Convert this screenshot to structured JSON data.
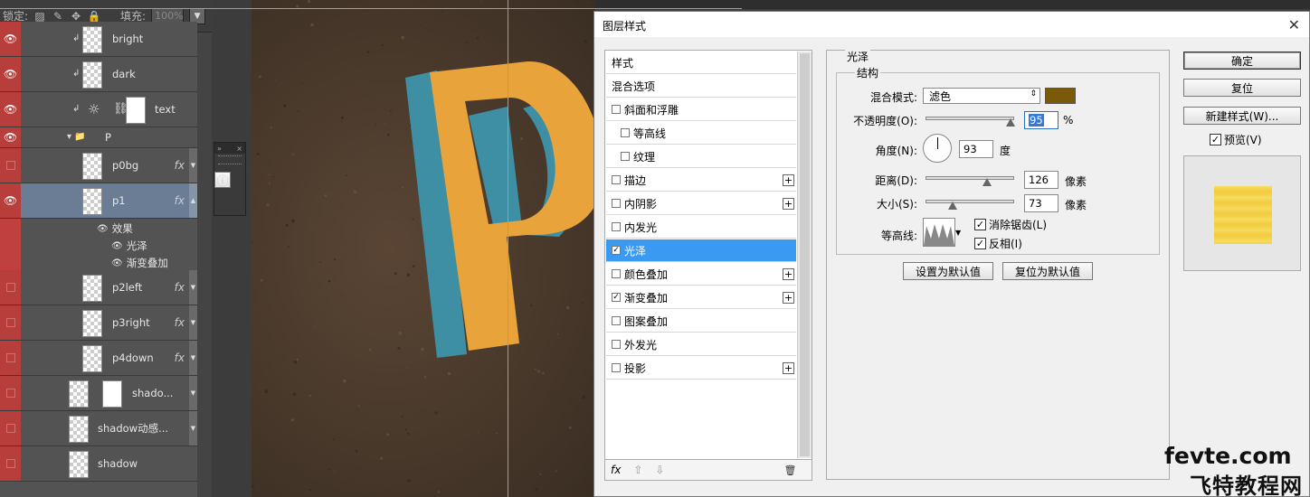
{
  "lock_bar": {
    "lock_label": "锁定:",
    "fill_label": "填充:",
    "fill_value": "100%"
  },
  "layers": {
    "rows": [
      {
        "name": "bright",
        "visible": true,
        "fx": false
      },
      {
        "name": "dark",
        "visible": true,
        "fx": false
      },
      {
        "name": "text",
        "visible": true,
        "fx": false
      },
      {
        "name": "P",
        "visible": true,
        "fx": false,
        "type": "group"
      },
      {
        "name": "p0bg",
        "visible": false,
        "fx": true,
        "fx_label": "fx"
      },
      {
        "name": "p1",
        "visible": true,
        "fx": true,
        "fx_label": "fx",
        "selected": true
      },
      {
        "name": "p2left",
        "visible": false,
        "fx": true,
        "fx_label": "fx"
      },
      {
        "name": "p3right",
        "visible": false,
        "fx": true,
        "fx_label": "fx"
      },
      {
        "name": "p4down",
        "visible": false,
        "fx": true,
        "fx_label": "fx"
      },
      {
        "name": "shado...",
        "visible": false,
        "fx": false
      },
      {
        "name": "shadow动感...",
        "visible": false,
        "fx": false
      },
      {
        "name": "shadow",
        "visible": false,
        "fx": false
      }
    ],
    "effects": {
      "header": "效果",
      "items": [
        "光泽",
        "渐变叠加"
      ]
    }
  },
  "canvas": {
    "letter": "P",
    "colors": {
      "face": "#e8a33a",
      "side": "#3e8fa3"
    }
  },
  "dialog": {
    "title": "图层样式",
    "styles": [
      {
        "label": "样式",
        "checkbox": false,
        "plus": false
      },
      {
        "label": "混合选项",
        "checkbox": false,
        "plus": false
      },
      {
        "label": "斜面和浮雕",
        "checkbox": true,
        "checked": false,
        "plus": false
      },
      {
        "label": "等高线",
        "checkbox": true,
        "checked": false,
        "plus": false,
        "indent": true
      },
      {
        "label": "纹理",
        "checkbox": true,
        "checked": false,
        "plus": false,
        "indent": true
      },
      {
        "label": "描边",
        "checkbox": true,
        "checked": false,
        "plus": true
      },
      {
        "label": "内阴影",
        "checkbox": true,
        "checked": false,
        "plus": true
      },
      {
        "label": "内发光",
        "checkbox": true,
        "checked": false,
        "plus": false
      },
      {
        "label": "光泽",
        "checkbox": true,
        "checked": true,
        "plus": false,
        "active": true
      },
      {
        "label": "颜色叠加",
        "checkbox": true,
        "checked": false,
        "plus": true
      },
      {
        "label": "渐变叠加",
        "checkbox": true,
        "checked": true,
        "plus": true
      },
      {
        "label": "图案叠加",
        "checkbox": true,
        "checked": false,
        "plus": false
      },
      {
        "label": "外发光",
        "checkbox": true,
        "checked": false,
        "plus": false
      },
      {
        "label": "投影",
        "checkbox": true,
        "checked": false,
        "plus": true
      }
    ],
    "list_footer": {
      "fx": "fx",
      "up": "⇧",
      "down": "⇩",
      "trash": "🗑"
    },
    "satin": {
      "section_title": "光泽",
      "structure_title": "结构",
      "blend_mode_label": "混合模式:",
      "blend_mode_value": "滤色",
      "blend_color": "#7a5a0a",
      "opacity_label": "不透明度(O):",
      "opacity_value": "95",
      "opacity_fraction": 0.95,
      "opacity_unit": "%",
      "angle_label": "角度(N):",
      "angle_value": "93",
      "angle_unit": "度",
      "distance_label": "距离(D):",
      "distance_value": "126",
      "distance_fraction": 0.68,
      "distance_unit": "像素",
      "size_label": "大小(S):",
      "size_value": "73",
      "size_fraction": 0.3,
      "size_unit": "像素",
      "contour_label": "等高线:",
      "antialias_label": "消除锯齿(L)",
      "antialias_checked": true,
      "invert_label": "反相(I)",
      "invert_checked": true,
      "set_default": "设置为默认值",
      "reset_default": "复位为默认值"
    },
    "buttons": {
      "ok": "确定",
      "reset": "复位",
      "new_style": "新建样式(W)...",
      "preview_label": "预览(V)",
      "preview_checked": true
    }
  },
  "watermark": {
    "line1": "fevte.com",
    "line2": "飞特教程网"
  }
}
